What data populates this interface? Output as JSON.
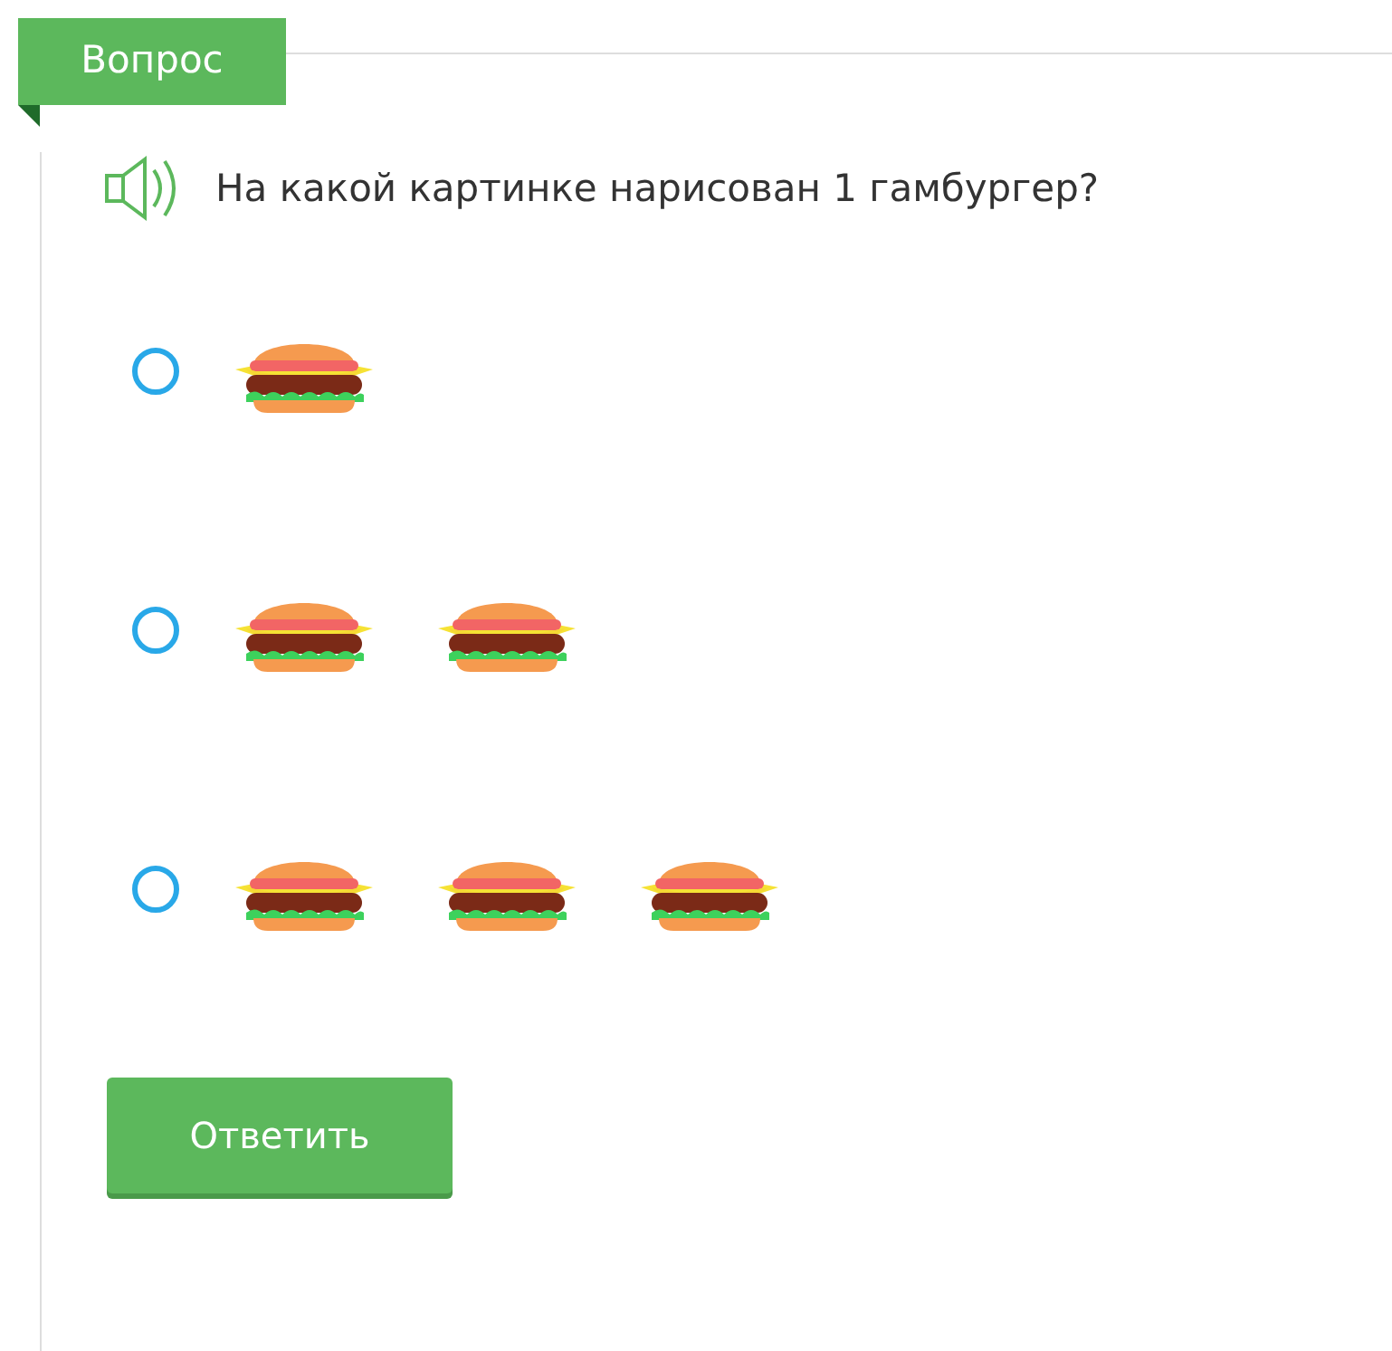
{
  "tab": {
    "label": "Вопрос"
  },
  "question": {
    "text": "На какой картинке нарисован 1 гамбургер?"
  },
  "options": [
    {
      "selected": false,
      "pictures": [
        {
          "kind": "burger"
        }
      ]
    },
    {
      "selected": false,
      "pictures": [
        {
          "kind": "burger"
        },
        {
          "kind": "burger"
        }
      ]
    },
    {
      "selected": false,
      "pictures": [
        {
          "kind": "burger"
        },
        {
          "kind": "burger"
        },
        {
          "kind": "burger"
        }
      ]
    }
  ],
  "submit": {
    "label": "Ответить"
  }
}
